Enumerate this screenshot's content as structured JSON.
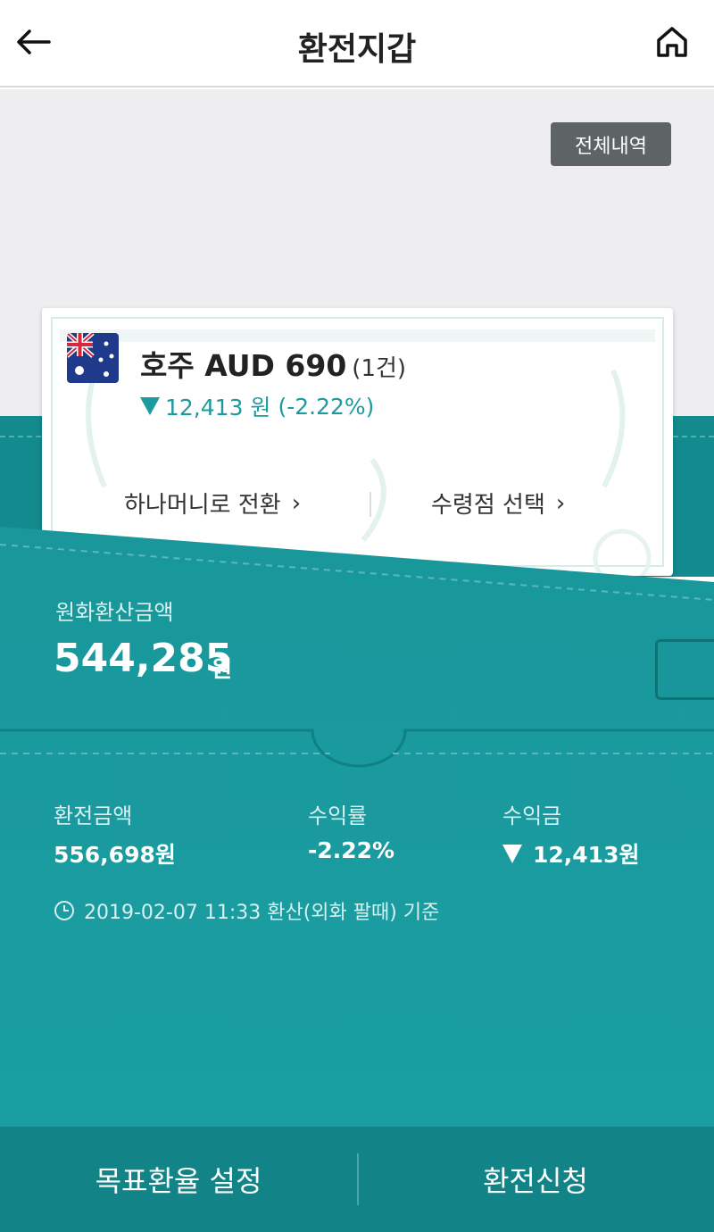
{
  "header": {
    "title": "환전지갑",
    "back_icon": "back-arrow-icon",
    "home_icon": "home-icon"
  },
  "history_button": "전체내역",
  "card": {
    "flag": "australia-flag",
    "title": "호주 AUD 690",
    "count": "(1건)",
    "change_amount": "12,413 원",
    "change_percent": "(-2.22%)",
    "link_left": "하나머니로 전환",
    "link_right": "수령점 선택",
    "chevron": "›"
  },
  "krw": {
    "label": "원화환산금액",
    "amount": "544,285",
    "unit": "원"
  },
  "stats": [
    {
      "label": "환전금액",
      "value": "556,698원"
    },
    {
      "label": "수익률",
      "value": "-2.22%"
    },
    {
      "label": "수익금",
      "value": "12,413원"
    }
  ],
  "timestamp": "2019-02-07 11:33 환산(외화 팔때) 기준",
  "bottom": {
    "left": "목표환율 설정",
    "right": "환전신청"
  },
  "colors": {
    "teal": "#1a9ca1",
    "teal_dark": "#128487",
    "text_light": "#d6f1f2",
    "history_bg": "#5e6365"
  }
}
